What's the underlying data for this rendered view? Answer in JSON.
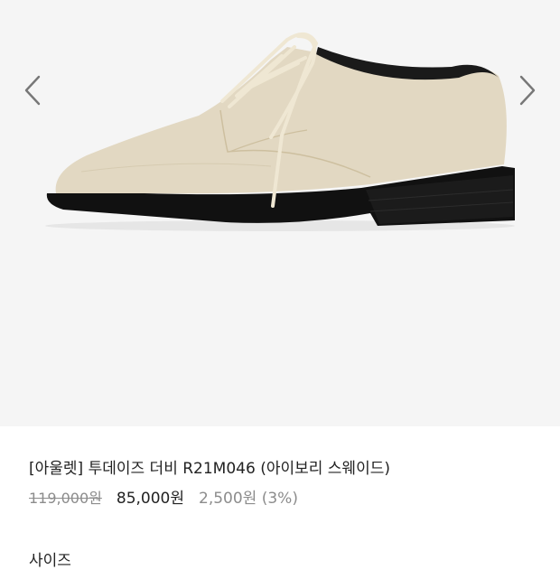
{
  "product": {
    "title": "[아울렛] 투데이즈 더비 R21M046 (아이보리 스웨이드)",
    "original_price": "119,000원",
    "sale_price": "85,000원",
    "point": "2,500원 (3%)"
  },
  "options": {
    "size_label": "사이즈"
  },
  "icons": {
    "prev": "chevron-left-icon",
    "next": "chevron-right-icon"
  },
  "colors": {
    "background": "#f5f5f5",
    "suede": "#e2d8c2",
    "sole": "#111111",
    "muted_text": "#8c8c8c"
  }
}
